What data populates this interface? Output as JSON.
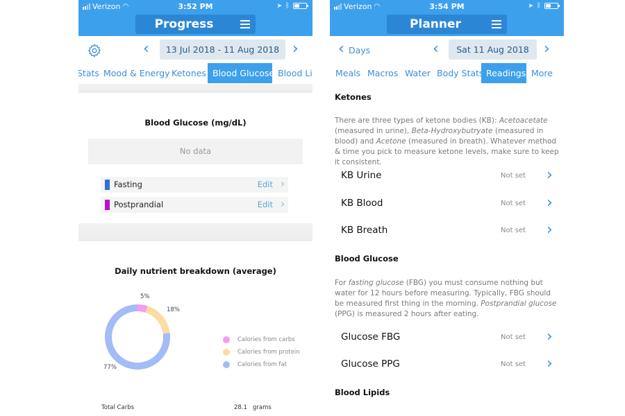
{
  "left": {
    "status": {
      "carrier": "Verizon",
      "time": "3:52 PM",
      "battery_level": 0.45
    },
    "header": {
      "title": "Progress",
      "menu_icon": "hamburger-icon"
    },
    "datebar": {
      "settings_icon": "gear-icon",
      "prev": "‹",
      "range": "13 Jul 2018 - 11 Aug 2018",
      "next": "›"
    },
    "tabs": [
      {
        "label": "Stats",
        "active": false
      },
      {
        "label": "Mood & Energy",
        "active": false
      },
      {
        "label": "Ketones",
        "active": false
      },
      {
        "label": "Blood Glucose",
        "active": true
      },
      {
        "label": "Blood Lip",
        "active": false
      }
    ],
    "glucose": {
      "title": "Blood Glucose (mg/dL)",
      "empty_text": "No data",
      "series": [
        {
          "label": "Fasting",
          "color": "#2f6fd8",
          "action": "Edit"
        },
        {
          "label": "Postprandial",
          "color": "#b514c9",
          "action": "Edit"
        }
      ]
    },
    "nutrients": {
      "title": "Daily nutrient breakdown (average)",
      "total_label": "Total Carbs",
      "total_value": "28.1",
      "total_unit": "grams"
    }
  },
  "chart_data": {
    "type": "pie",
    "title": "Daily nutrient breakdown (average)",
    "donut": true,
    "categories": [
      "Calories from carbs",
      "Calories from protein",
      "Calories from fat"
    ],
    "values": [
      5,
      18,
      77
    ],
    "labels": [
      "5%",
      "18%",
      "77%"
    ],
    "colors": [
      "#f79af0",
      "#fbdca4",
      "#a3bcf5"
    ],
    "legend": "right"
  },
  "right": {
    "status": {
      "carrier": "Verizon",
      "time": "3:54 PM",
      "battery_level": 0.45
    },
    "header": {
      "title": "Planner",
      "menu_icon": "hamburger-icon"
    },
    "datebar": {
      "back_label": "Days",
      "prev": "‹",
      "date": "Sat 11 Aug 2018",
      "next": "›"
    },
    "tabs": [
      {
        "label": "Meals",
        "active": false
      },
      {
        "label": "Macros",
        "active": false
      },
      {
        "label": "Water",
        "active": false
      },
      {
        "label": "Body Stats",
        "active": false
      },
      {
        "label": "Readings",
        "active": true
      },
      {
        "label": "More",
        "active": false
      }
    ],
    "sections": {
      "ketones": {
        "title": "Ketones",
        "description": [
          {
            "t": "There are three types of ketone bodies (KB): "
          },
          {
            "t": "Acetoacetate",
            "i": true
          },
          {
            "t": " (measured in urine), "
          },
          {
            "t": "Beta-Hydroxybutryate",
            "i": true
          },
          {
            "t": " (measured in blood) and "
          },
          {
            "t": "Acetone",
            "i": true
          },
          {
            "t": " (measured in breath). Whatever method & time you pick to measure ketone levels, make sure to keep it consistent."
          }
        ],
        "rows": [
          {
            "name": "KB Urine",
            "value": "Not set"
          },
          {
            "name": "KB Blood",
            "value": "Not set"
          },
          {
            "name": "KB Breath",
            "value": "Not set"
          }
        ]
      },
      "glucose": {
        "title": "Blood Glucose",
        "description": [
          {
            "t": "For "
          },
          {
            "t": "fasting glucose",
            "i": true
          },
          {
            "t": " (FBG) you must consume nothing but water for 12 hours before measuring. Typically, FBG should be measured first thing in the morning. "
          },
          {
            "t": "Postprandial glucose",
            "i": true
          },
          {
            "t": " (PPG) is measured 2 hours after eating."
          }
        ],
        "rows": [
          {
            "name": "Glucose FBG",
            "value": "Not set"
          },
          {
            "name": "Glucose PPG",
            "value": "Not set"
          }
        ]
      },
      "lipids": {
        "title": "Blood Lipids"
      }
    }
  }
}
